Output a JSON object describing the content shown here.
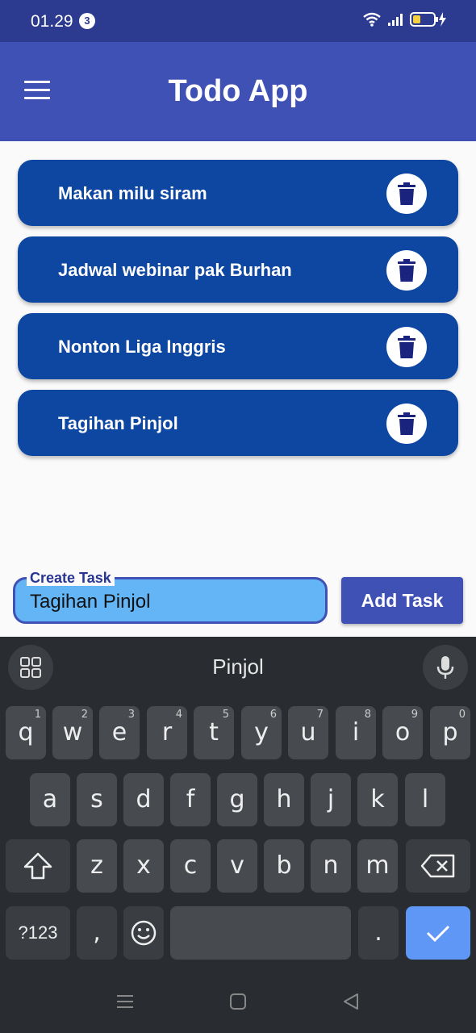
{
  "status_bar": {
    "time": "01.29",
    "notification_count": "3",
    "icons": [
      "wifi-icon",
      "signal-icon",
      "battery-charging-icon"
    ]
  },
  "app_bar": {
    "menu_icon": "hamburger-menu-icon",
    "title": "Todo App"
  },
  "tasks": [
    {
      "label": "Makan milu siram",
      "action_icon": "trash-icon"
    },
    {
      "label": "Jadwal webinar pak Burhan",
      "action_icon": "trash-icon"
    },
    {
      "label": "Nonton Liga Inggris",
      "action_icon": "trash-icon"
    },
    {
      "label": "Tagihan Pinjol",
      "action_icon": "trash-icon"
    }
  ],
  "task_input": {
    "label": "Create Task",
    "value": "Tagihan Pinjol"
  },
  "add_button": {
    "label": "Add Task"
  },
  "keyboard": {
    "suggestion": "Pinjol",
    "row1": [
      {
        "key": "q",
        "hint": "1"
      },
      {
        "key": "w",
        "hint": "2"
      },
      {
        "key": "e",
        "hint": "3"
      },
      {
        "key": "r",
        "hint": "4"
      },
      {
        "key": "t",
        "hint": "5"
      },
      {
        "key": "y",
        "hint": "6"
      },
      {
        "key": "u",
        "hint": "7"
      },
      {
        "key": "i",
        "hint": "8"
      },
      {
        "key": "o",
        "hint": "9"
      },
      {
        "key": "p",
        "hint": "0"
      }
    ],
    "row2": [
      "a",
      "s",
      "d",
      "f",
      "g",
      "h",
      "j",
      "k",
      "l"
    ],
    "row3": [
      "z",
      "x",
      "c",
      "v",
      "b",
      "n",
      "m"
    ],
    "symbols_key": "?123",
    "comma_key": ",",
    "period_key": "."
  },
  "colors": {
    "status_bar": "#2c3a8f",
    "app_bar": "#3f51b5",
    "task_card": "#0d47a1",
    "input_fill": "#64b5f6",
    "keyboard_bg": "#292c30",
    "enter_key": "#5e97f6"
  }
}
